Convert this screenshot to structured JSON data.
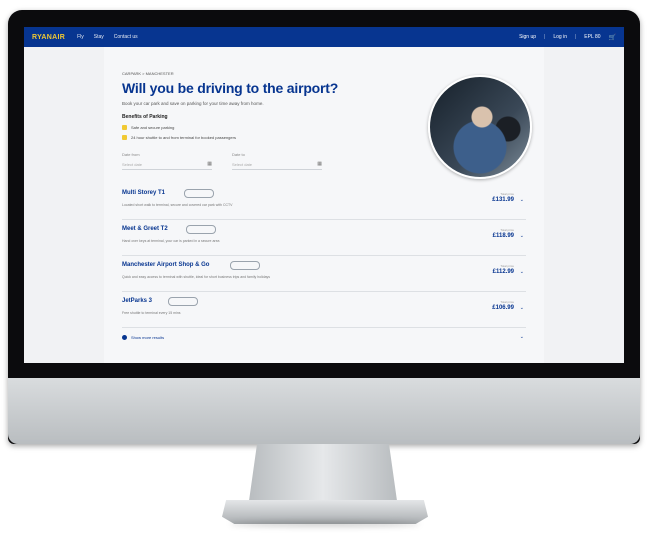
{
  "nav": {
    "logo": "RYANAIR",
    "links": [
      "Fly",
      "Stay",
      "Contact us"
    ],
    "sign_up": "Sign up",
    "log_in": "Log in",
    "currency": "EPL 80"
  },
  "page": {
    "breadcrumb": "CARPARK > MANCHESTER",
    "title": "Will you be driving to the airport?",
    "subtitle": "Book your car park and save on parking for your time away from home.",
    "benefits_title": "Benefits of Parking",
    "benefits": [
      "Safe and secure parking",
      "24 hour shuttle to and from terminal for booked passengers"
    ]
  },
  "form": {
    "from_label": "Date from",
    "from_placeholder": "Select date",
    "to_label": "Date to",
    "to_placeholder": "Select date"
  },
  "parking": [
    {
      "name": "Multi Storey T1",
      "desc": "Located short walk to terminal, secure and covered car park with CCTV",
      "price_label": "Total price",
      "price": "£131.99"
    },
    {
      "name": "Meet & Greet T2",
      "desc": "Hand over keys at terminal, your car is parked in a secure area",
      "price_label": "Total price",
      "price": "£118.99"
    },
    {
      "name": "Manchester Airport Shop & Go",
      "desc": "Quick and easy access to terminal with shuttle, ideal for short business trips and family holidays",
      "price_label": "Total price",
      "price": "£112.99"
    },
    {
      "name": "JetParks 3",
      "desc": "Free shuttle to terminal every 15 mins",
      "price_label": "Total price",
      "price": "£106.99"
    }
  ],
  "more_label": "Show more results",
  "colors": {
    "brand": "#073590",
    "accent": "#f1c933"
  }
}
